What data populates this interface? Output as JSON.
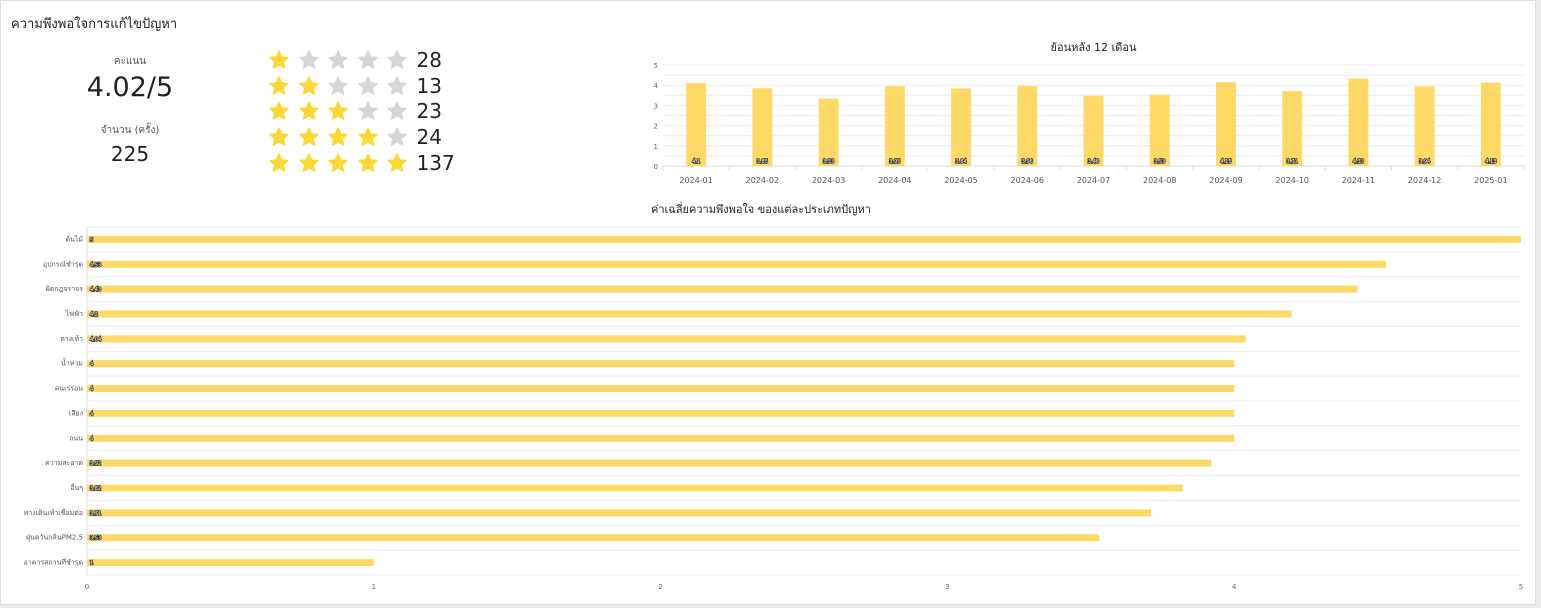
{
  "title": "ความพึงพอใจการแก้ไขปัญหา",
  "summary": {
    "score_label": "คะแนน",
    "score_value": "4.02/5",
    "count_label": "จำนวน (ครั้ง)",
    "count_value": "225"
  },
  "ratings": [
    {
      "stars": 1,
      "count": "28"
    },
    {
      "stars": 2,
      "count": "13"
    },
    {
      "stars": 3,
      "count": "23"
    },
    {
      "stars": 4,
      "count": "24"
    },
    {
      "stars": 5,
      "count": "137"
    }
  ],
  "colors": {
    "bar": "#fed965",
    "star_on": "#fdd835",
    "star_off": "#d6d6d6"
  },
  "chart_data": [
    {
      "type": "bar",
      "title": "ย้อนหลัง 12 เดือน",
      "categories": [
        "2024-01",
        "2024-02",
        "2024-03",
        "2024-04",
        "2024-05",
        "2024-06",
        "2024-07",
        "2024-08",
        "2024-09",
        "2024-10",
        "2024-11",
        "2024-12",
        "2025-01"
      ],
      "values": [
        4.1,
        3.85,
        3.33,
        3.95,
        3.84,
        3.96,
        3.48,
        3.53,
        4.15,
        3.71,
        4.33,
        3.94,
        4.13
      ],
      "data_labels": [
        "4.1",
        "3.85",
        "3.33",
        "3.95",
        "3.84",
        "3.96",
        "3.48",
        "3.53",
        "4.15",
        "3.71",
        "4.33",
        "3.94",
        "4.13"
      ],
      "ylim": [
        0,
        5
      ],
      "yticks": [
        "0",
        "1",
        "2",
        "3",
        "4",
        "5"
      ],
      "grid": true
    },
    {
      "type": "bar",
      "orientation": "horizontal",
      "title": "ค่าเฉลี่ยความพึงพอใจ ของแต่ละประเภทปัญหา",
      "categories": [
        "ต้นไม้",
        "อุปกรณ์ชำรุด",
        "ผิดกฎจราจร",
        "ไฟฟ้า",
        "ทางเท้า",
        "น้ำท่วม",
        "คนเร่ร่อน",
        "เสียง",
        "ถนน",
        "ความสะอาด",
        "อื่นๆ",
        "ทางเดินเท้าเชื่อมต่อ",
        "ฝุ่นควันกลิ่นPM2.5",
        "อาคารสถานที่ชำรุด"
      ],
      "values": [
        5,
        4.53,
        4.43,
        4.2,
        4.04,
        4,
        4,
        4,
        4,
        3.92,
        3.82,
        3.71,
        3.53,
        1
      ],
      "data_labels": [
        "5",
        "4.53",
        "4.43",
        "4.2",
        "4.04",
        "4",
        "4",
        "4",
        "4",
        "3.92",
        "3.82",
        "3.71",
        "3.53",
        "1"
      ],
      "xlim": [
        0,
        5
      ],
      "xticks": [
        "0",
        "1",
        "2",
        "3",
        "4",
        "5"
      ],
      "grid": true
    }
  ]
}
